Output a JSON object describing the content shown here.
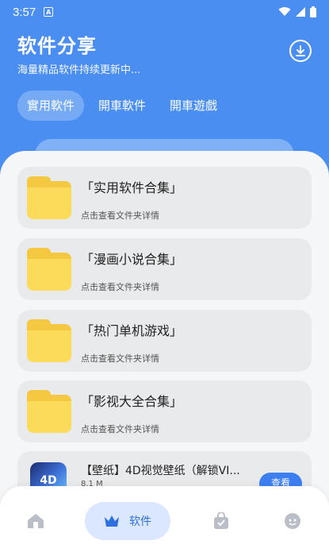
{
  "status_bar": {
    "time": "3:57",
    "a_label": "A",
    "icons": [
      "wifi-icon",
      "signal-icon",
      "battery-icon"
    ]
  },
  "header": {
    "title": "软件分享",
    "subtitle": "海量精品软件持续更新中..."
  },
  "tabs": [
    {
      "label": "實用軟件",
      "active": true
    },
    {
      "label": "開車軟件",
      "active": false
    },
    {
      "label": "開車遊戲",
      "active": false
    }
  ],
  "folders": [
    {
      "name": "「实用软件合集」",
      "desc": "点击查看文件夹详情"
    },
    {
      "name": "「漫画小说合集」",
      "desc": "点击查看文件夹详情"
    },
    {
      "name": "「热门单机游戏」",
      "desc": "点击查看文件夹详情"
    },
    {
      "name": "「影视大全合集」",
      "desc": "点击查看文件夹详情"
    }
  ],
  "app_item": {
    "name": "【壁纸】4D视觉壁纸（解锁VI...",
    "size": "8.1 M",
    "icon_text": "4D",
    "button": "查看"
  },
  "bottom_nav": [
    {
      "icon": "home-icon",
      "label": ""
    },
    {
      "icon": "crown-icon",
      "label": "软件",
      "active": true
    },
    {
      "icon": "bag-icon",
      "label": ""
    },
    {
      "icon": "user-icon",
      "label": ""
    }
  ],
  "colors": {
    "primary": "#4a8ef2",
    "button": "#3d7ff0",
    "folder": "#fddb5a",
    "nav_active_bg": "#dbe7ff",
    "nav_active_text": "#2f6fe0"
  }
}
